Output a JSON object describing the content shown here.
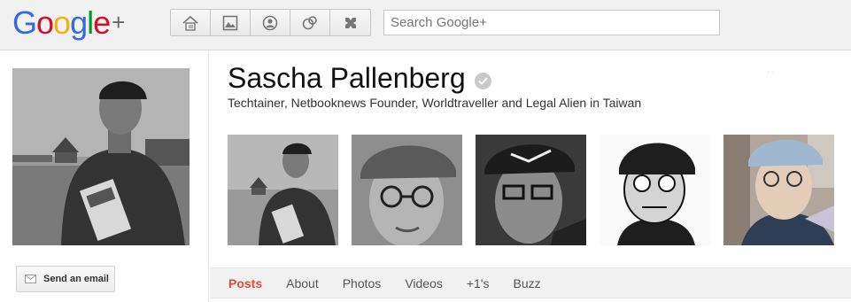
{
  "header": {
    "logo_text": "Google",
    "logo_plus": "+",
    "nav": [
      {
        "icon": "home-icon"
      },
      {
        "icon": "photos-icon"
      },
      {
        "icon": "profile-icon"
      },
      {
        "icon": "circles-icon"
      },
      {
        "icon": "games-icon"
      }
    ],
    "search_placeholder": "Search Google+"
  },
  "profile": {
    "name": "Sascha Pallenberg",
    "tagline": "Techtainer, Netbooknews Founder, Worldtraveller and Legal Alien in Taiwan",
    "email_button": "Send an email"
  },
  "tabs": [
    {
      "label": "Posts",
      "active": true
    },
    {
      "label": "About",
      "active": false
    },
    {
      "label": "Photos",
      "active": false
    },
    {
      "label": "Videos",
      "active": false
    },
    {
      "label": "+1's",
      "active": false
    },
    {
      "label": "Buzz",
      "active": false
    }
  ],
  "colors": {
    "accent": "#dd4b39",
    "topbar": "#f1f1f1"
  }
}
